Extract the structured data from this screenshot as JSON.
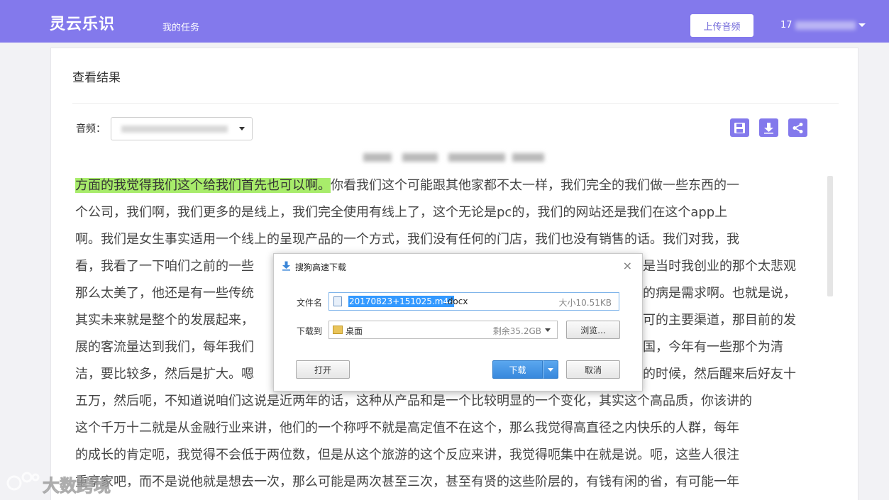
{
  "header": {
    "logo": "灵云乐识",
    "nav_tasks": "我的任务",
    "upload_label": "上传音频",
    "user_prefix": "17"
  },
  "main": {
    "title": "查看结果",
    "audio_label": "音频："
  },
  "transcript": {
    "highlight": "方面的我觉得我们这个给我们首先也可以啊。",
    "line1_rest": "你看我们这个可能跟其他家都不太一样，我们完全的我们做一些东西的一",
    "lines": [
      "个公司，我们啊，我们更多的是线上，我们完全使用有线上了，这个无论是pc的，我们的网站还是我们在这个app上",
      "啊。我们是女生事实适用一个线上的呈现产品的一个方式，我们没有任何的门店，我们也没有销售的话。我们对我，我",
      "看，我看了一下咱们之前的一些",
      "那么太美了，他还是有一些传统",
      "其实未来就是整个的发展起来，",
      "展的客流量达到我们，每年我们",
      "洁，要比较多，然后是扩大。嗯",
      "五万，然后呃，不知道说咱们这说是近两年的话，这种从产品和是一个比较明显的一个变化，其实这个高品质，你该讲的",
      "这个千万十二就是从金融行业来讲，他们的一个称呼不就是高定值不在这个，那么我觉得高直径之内快乐的人群，每年",
      "的成长的肯定呃，我觉得不会低于两位数，但是从这个旅游的这个反应来讲，我觉得呃集中在就是说。呃，这些人很注",
      "重享家吧，而不是说他就是想去一次，那么可能是两次甚至三次，甚至有贤的这些阶层的，有钱有闲的省，有可能一年"
    ],
    "right_fragments": [
      "是当时我创业的那个太悲观",
      "的病是需求啊。也就是说，",
      "可的主要渠道，那目前的发",
      "国，今年有一些那个为清",
      "的时候，然后醒来后好友十"
    ]
  },
  "dialog": {
    "title": "搜狗高速下载",
    "close_glyph": "×",
    "filename_label": "文件名",
    "filename_selected": "20170823+151025.m4a",
    "filename_ext": ".docx",
    "file_size": "大小10.51KB",
    "saveto_label": "下载到",
    "path": "桌面",
    "free_space": "剩余35.2GB",
    "browse_label": "浏览...",
    "open_label": "打开",
    "download_label": "下载",
    "cancel_label": "取消"
  },
  "watermark": {
    "text": "大数跨境"
  },
  "colors": {
    "accent": "#8379ec",
    "highlight": "#a8ec6b",
    "selection": "#3399ff"
  },
  "icons": [
    "save-icon",
    "download-icon",
    "share-icon",
    "download-arrow-icon",
    "close-icon",
    "doc-file-icon",
    "folder-icon",
    "chevron-down-icon"
  ]
}
